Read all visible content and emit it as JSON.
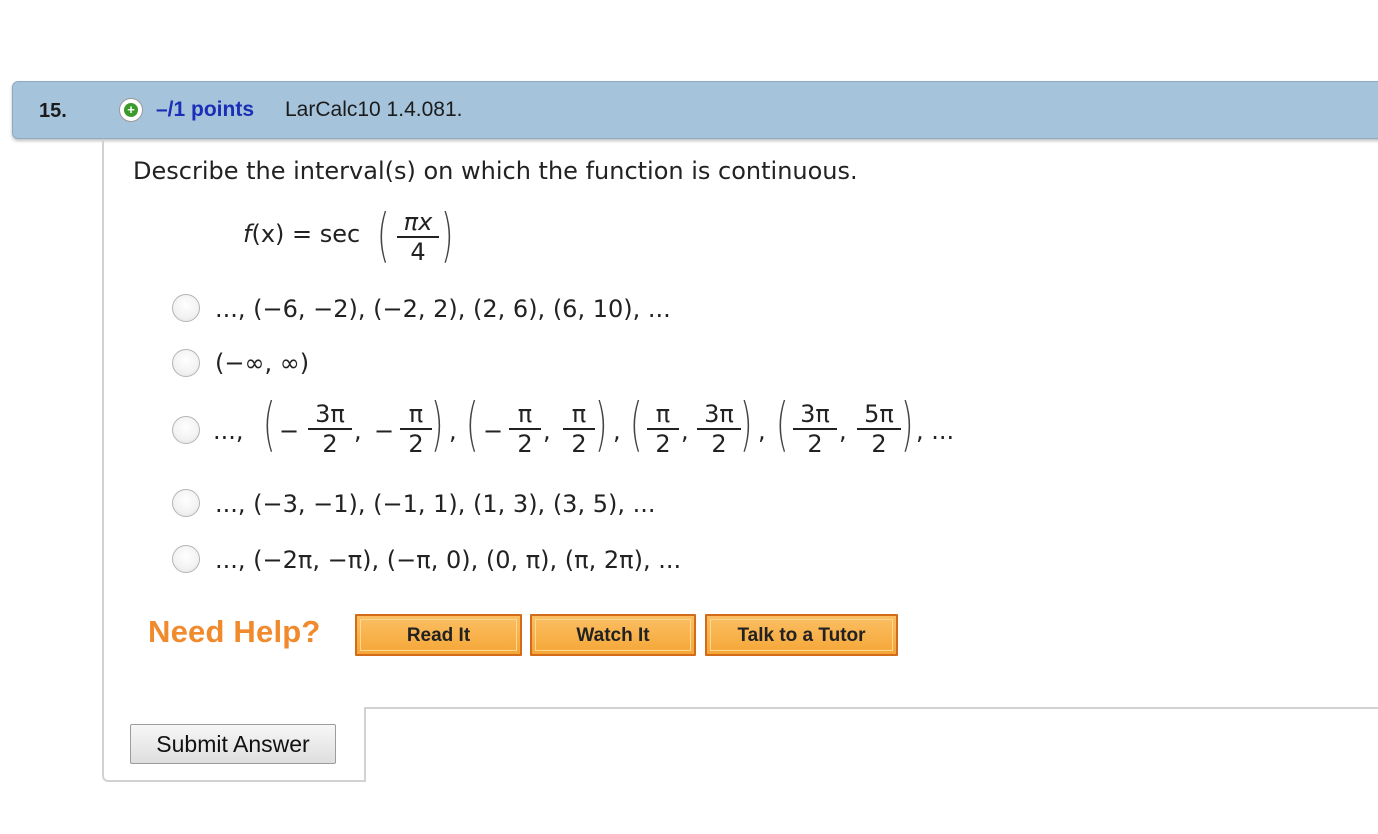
{
  "question": {
    "number": "15.",
    "points": "–/1 points",
    "id": "LarCalc10 1.4.081.",
    "prompt": "Describe the interval(s) on which the function is continuous."
  },
  "function": {
    "lhs_f": "f",
    "lhs_rest": "(x)",
    "eq": " = sec",
    "num": "πx",
    "den": "4"
  },
  "options": {
    "o1": "..., (−6, −2), (−2, 2), (2, 6), (6, 10), ...",
    "o2": "(−∞, ∞)",
    "o3": {
      "lead": "...,",
      "f1n": "3π",
      "f1d": "2",
      "f2n": "π",
      "f2d": "2",
      "f3n": "π",
      "f3d": "2",
      "f4n": "π",
      "f4d": "2",
      "f5n": "π",
      "f5d": "2",
      "f6n": "3π",
      "f6d": "2",
      "f7n": "3π",
      "f7d": "2",
      "f8n": "5π",
      "f8d": "2",
      "minus": "−",
      "comma": ",",
      "tail": ", ..."
    },
    "o4": "..., (−3, −1), (−1, 1), (1, 3), (3, 5), ...",
    "o5": "..., (−2π, −π), (−π, 0), (0, π), (π, 2π), ..."
  },
  "help": {
    "label": "Need Help?",
    "read": "Read It",
    "watch": "Watch It",
    "tutor": "Talk to a Tutor"
  },
  "submit_label": "Submit Answer",
  "colors": {
    "header_bg": "#a6c3dc",
    "points": "#1a2fb5",
    "need_help": "#f08a2c",
    "help_button": "#f5a637"
  }
}
